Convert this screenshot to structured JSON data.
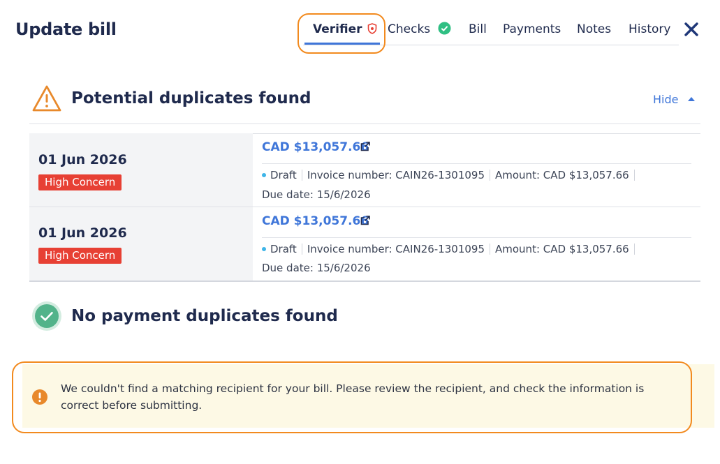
{
  "header": {
    "title": "Update bill",
    "tabs": [
      {
        "label": "Verifier",
        "active": true
      },
      {
        "label": "Checks",
        "active": false
      },
      {
        "label": "Bill",
        "active": false
      },
      {
        "label": "Payments",
        "active": false
      },
      {
        "label": "Notes",
        "active": false
      },
      {
        "label": "History",
        "active": false
      }
    ]
  },
  "duplicates": {
    "heading": "Potential duplicates found",
    "toggle_label": "Hide",
    "rows": [
      {
        "date": "01 Jun 2026",
        "badge": "High Concern",
        "amount_link": "CAD $13,057.66",
        "status": "Draft",
        "invoice": "Invoice number: CAIN26-1301095",
        "amount": "Amount: CAD $13,057.66",
        "due": "Due date: 15/6/2026"
      },
      {
        "date": "01 Jun 2026",
        "badge": "High Concern",
        "amount_link": "CAD $13,057.66",
        "status": "Draft",
        "invoice": "Invoice number: CAIN26-1301095",
        "amount": "Amount: CAD $13,057.66",
        "due": "Due date: 15/6/2026"
      }
    ]
  },
  "payment_check": {
    "heading": "No payment duplicates found"
  },
  "alert": {
    "message": "We couldn't find a matching recipient for your bill. Please review the recipient, and check the information is correct before submitting."
  },
  "colors": {
    "accent": "#3f76d9",
    "warning_orange": "#e8892b",
    "danger": "#e74034",
    "success": "#52b38a",
    "alert_bg": "#fdf9e5",
    "annotation": "#f28a1e"
  }
}
